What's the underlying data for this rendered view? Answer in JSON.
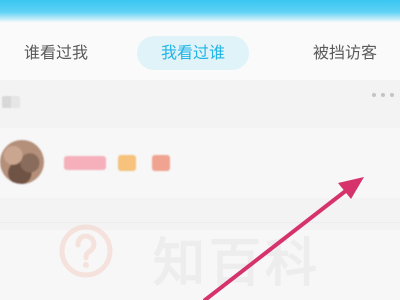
{
  "tabs": [
    {
      "label": "谁看过我"
    },
    {
      "label": "我看过谁",
      "selected": true
    },
    {
      "label": "被挡访客"
    }
  ],
  "row": {
    "more_icon": "more-dots-icon"
  },
  "watermark": {
    "icon": "question-circle-icon",
    "text": "知百科"
  },
  "annotation": {
    "icon": "arrow-icon",
    "color": "#d6336c"
  },
  "colors": {
    "accent": "#22b4e6",
    "selected_tab_bg": "#dff3f9"
  }
}
